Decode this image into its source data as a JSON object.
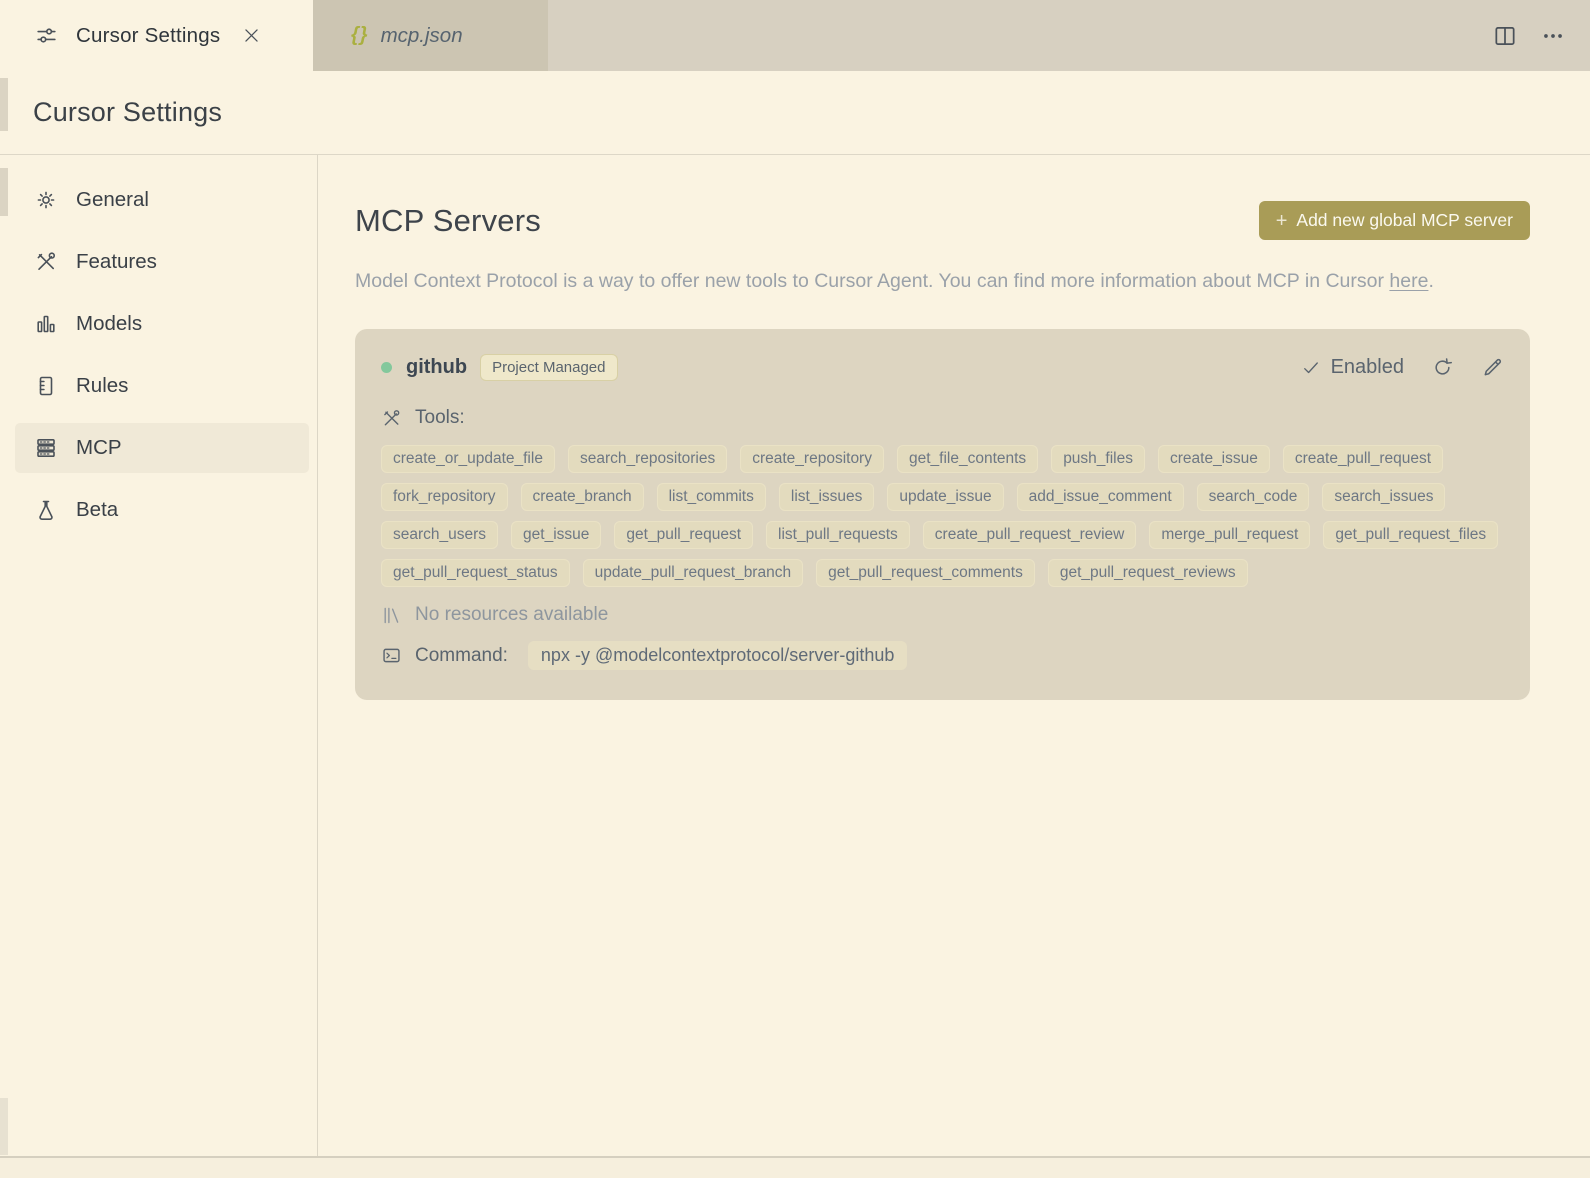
{
  "tab_bar": {
    "active_tab": {
      "label": "Cursor Settings",
      "icon": "sliders-icon"
    },
    "preview_tab": {
      "label": "mcp.json",
      "icon_glyph": "{}"
    }
  },
  "page_title": "Cursor Settings",
  "sidebar": {
    "items": [
      {
        "label": "General",
        "icon": "gear-icon",
        "active": false
      },
      {
        "label": "Features",
        "icon": "tools-icon",
        "active": false
      },
      {
        "label": "Models",
        "icon": "bar-chart-icon",
        "active": false
      },
      {
        "label": "Rules",
        "icon": "ruled-document-icon",
        "active": false
      },
      {
        "label": "MCP",
        "icon": "server-stack-icon",
        "active": true
      },
      {
        "label": "Beta",
        "icon": "flask-icon",
        "active": false
      }
    ]
  },
  "main": {
    "heading": "MCP Servers",
    "add_button": {
      "plus": "+",
      "label": "Add new global MCP server",
      "color": "#a99c57"
    },
    "description": {
      "before_link": "Model Context Protocol is a way to offer new tools to Cursor Agent. You can find more information about MCP in Cursor ",
      "link_text": "here",
      "after_link": "."
    },
    "server_card": {
      "status_dot_color": "#83c89c",
      "name": "github",
      "badge": "Project Managed",
      "enabled_label": "Enabled",
      "tools_label": "Tools:",
      "tools": [
        "create_or_update_file",
        "search_repositories",
        "create_repository",
        "get_file_contents",
        "push_files",
        "create_issue",
        "create_pull_request",
        "fork_repository",
        "create_branch",
        "list_commits",
        "list_issues",
        "update_issue",
        "add_issue_comment",
        "search_code",
        "search_issues",
        "search_users",
        "get_issue",
        "get_pull_request",
        "list_pull_requests",
        "create_pull_request_review",
        "merge_pull_request",
        "get_pull_request_files",
        "get_pull_request_status",
        "update_pull_request_branch",
        "get_pull_request_comments",
        "get_pull_request_reviews"
      ],
      "resources_text": "No resources available",
      "command_label": "Command:",
      "command_value": "npx -y @modelcontextprotocol/server-github"
    }
  }
}
